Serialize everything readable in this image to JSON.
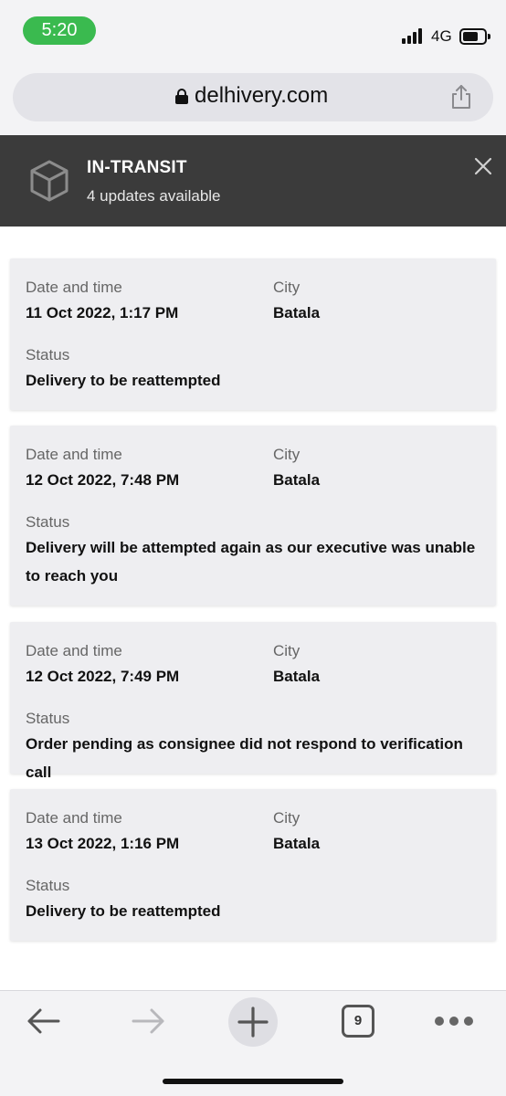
{
  "status_bar": {
    "time": "5:20",
    "network": "4G",
    "time_pill_color": "#3aba4f"
  },
  "browser": {
    "url": "delhivery.com"
  },
  "header": {
    "title": "IN-TRANSIT",
    "subtitle": "4 updates available",
    "icon": "package-box-icon",
    "background_color": "#3b3b3b"
  },
  "labels": {
    "date_time": "Date and time",
    "city": "City",
    "status": "Status"
  },
  "updates": [
    {
      "date_time": "11 Oct 2022, 1:17 PM",
      "city": "Batala",
      "status": "Delivery to be reattempted"
    },
    {
      "date_time": "12 Oct 2022, 7:48 PM",
      "city": "Batala",
      "status": "Delivery will be attempted again as our executive was unable to reach you"
    },
    {
      "date_time": "12 Oct 2022, 7:49 PM",
      "city": "Batala",
      "status": "Order pending as consignee did not respond to verification call"
    },
    {
      "date_time": "13 Oct 2022, 1:16 PM",
      "city": "Batala",
      "status": "Delivery to be reattempted"
    }
  ],
  "toolbar": {
    "tab_count": "9",
    "icons": [
      "back-arrow-icon",
      "forward-arrow-icon",
      "plus-icon",
      "tabs-icon",
      "more-dots-icon"
    ]
  }
}
